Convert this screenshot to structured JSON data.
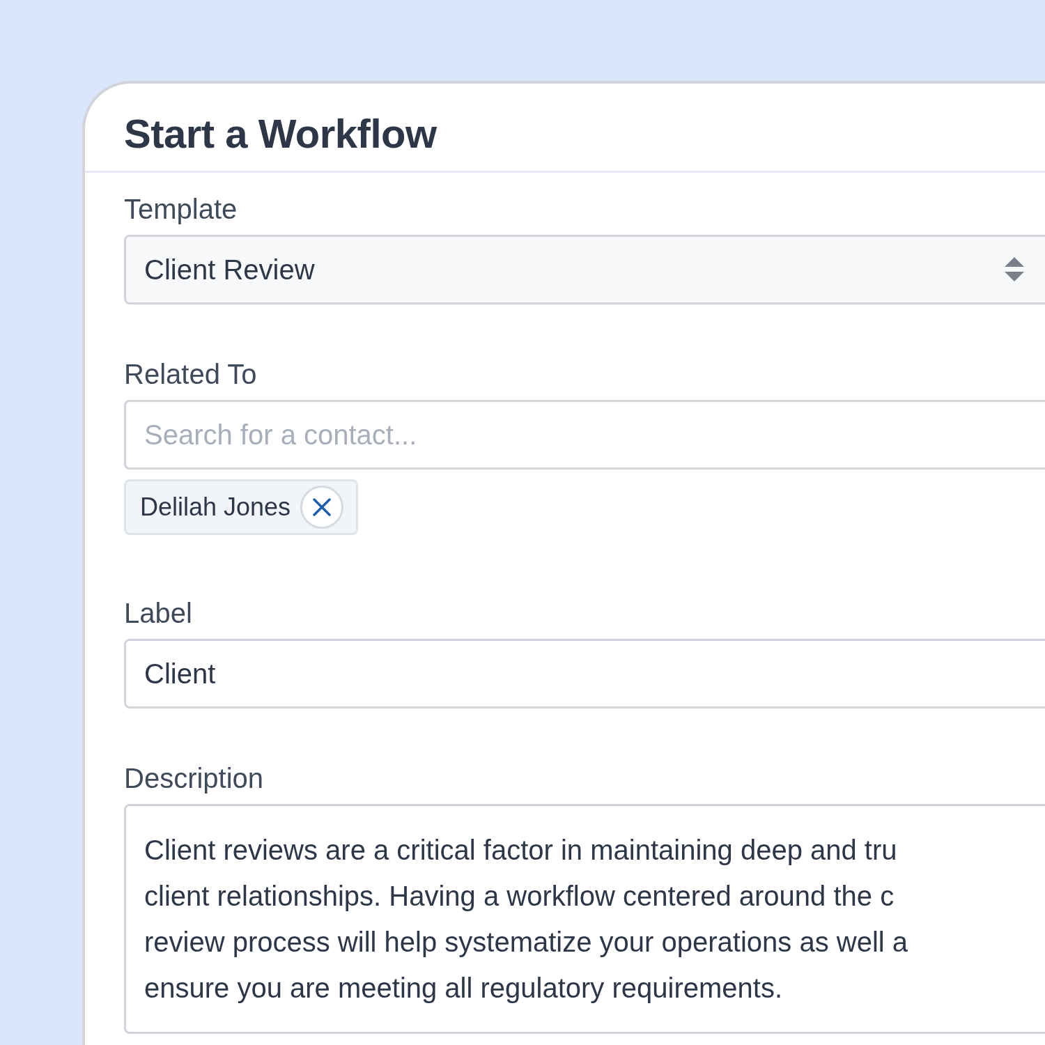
{
  "dialog": {
    "title": "Start a Workflow"
  },
  "fields": [
    {
      "kind": "select",
      "label": "Template",
      "value": "Client Review"
    },
    {
      "kind": "search",
      "label": "Related To",
      "placeholder": "Search for a contact...",
      "chips": [
        {
          "label": "Delilah Jones"
        }
      ]
    },
    {
      "kind": "text",
      "label": "Label",
      "value": "Client"
    },
    {
      "kind": "textarea",
      "label": "Description",
      "lines": [
        "Client reviews are a critical factor in maintaining deep and tru",
        "client relationships. Having a workflow centered around the c",
        "review process will help systematize your operations as well a",
        "ensure you are meeting all regulatory requirements."
      ]
    }
  ]
}
